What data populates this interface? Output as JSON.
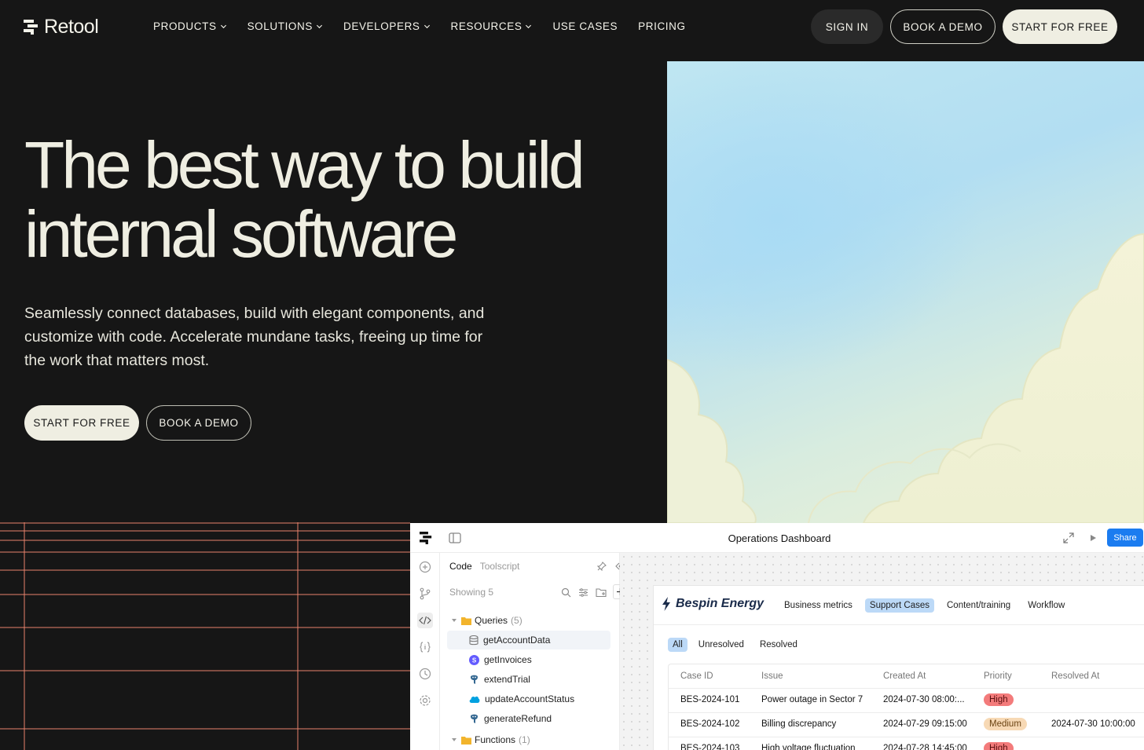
{
  "nav": {
    "logo_text": "Retool",
    "links": [
      {
        "label": "PRODUCTS",
        "dropdown": true
      },
      {
        "label": "SOLUTIONS",
        "dropdown": true
      },
      {
        "label": "DEVELOPERS",
        "dropdown": true
      },
      {
        "label": "RESOURCES",
        "dropdown": true
      },
      {
        "label": "USE CASES",
        "dropdown": false
      },
      {
        "label": "PRICING",
        "dropdown": false
      }
    ],
    "sign_in": "SIGN IN",
    "book_demo": "BOOK A DEMO",
    "start_free": "START FOR FREE"
  },
  "hero": {
    "title_line1": "The best way to build",
    "title_line2": "internal software",
    "subtitle": "Seamlessly connect databases, build with elegant components, and customize with code. Accelerate mundane tasks, freeing up time for the work that matters most.",
    "cta_start": "START FOR FREE",
    "cta_demo": "BOOK A DEMO"
  },
  "app": {
    "title": "Operations Dashboard",
    "share": "Share",
    "panel": {
      "tab_code": "Code",
      "tab_toolscript": "Toolscript",
      "showing": "Showing 5",
      "queries_label": "Queries",
      "queries_count": "(5)",
      "queries": [
        {
          "name": "getAccountData",
          "icon": "database-icon"
        },
        {
          "name": "getInvoices",
          "icon": "stripe-icon"
        },
        {
          "name": "extendTrial",
          "icon": "postgres-icon"
        },
        {
          "name": "updateAccountStatus",
          "icon": "salesforce-icon"
        },
        {
          "name": "generateRefund",
          "icon": "postgres-icon"
        }
      ],
      "functions_label": "Functions",
      "functions_count": "(1)"
    },
    "dashboard": {
      "brand": "Bespin Energy",
      "tabs": [
        "Business metrics",
        "Support Cases",
        "Content/training",
        "Workflow"
      ],
      "active_tab": "Support Cases",
      "filters": [
        "All",
        "Unresolved",
        "Resolved"
      ],
      "active_filter": "All",
      "columns": [
        "Case ID",
        "Issue",
        "Created At",
        "Priority",
        "Resolved At"
      ],
      "rows": [
        {
          "id": "BES-2024-101",
          "issue": "Power outage in Sector 7",
          "created": "2024-07-30 08:00:...",
          "priority": "High",
          "resolved": ""
        },
        {
          "id": "BES-2024-102",
          "issue": "Billing discrepancy",
          "created": "2024-07-29 09:15:00",
          "priority": "Medium",
          "resolved": "2024-07-30 10:00:00"
        },
        {
          "id": "BES-2024-103",
          "issue": "High voltage fluctuation",
          "created": "2024-07-28 14:45:00",
          "priority": "High",
          "resolved": ""
        }
      ]
    }
  },
  "colors": {
    "background": "#161616",
    "cream": "#efeee2",
    "grid_line": "#e8836c",
    "share_blue": "#1b7cf0",
    "priority_high_bg": "#f37b7b",
    "priority_medium_bg": "#f7d9b5",
    "active_tab_bg": "#bcd9f7"
  }
}
